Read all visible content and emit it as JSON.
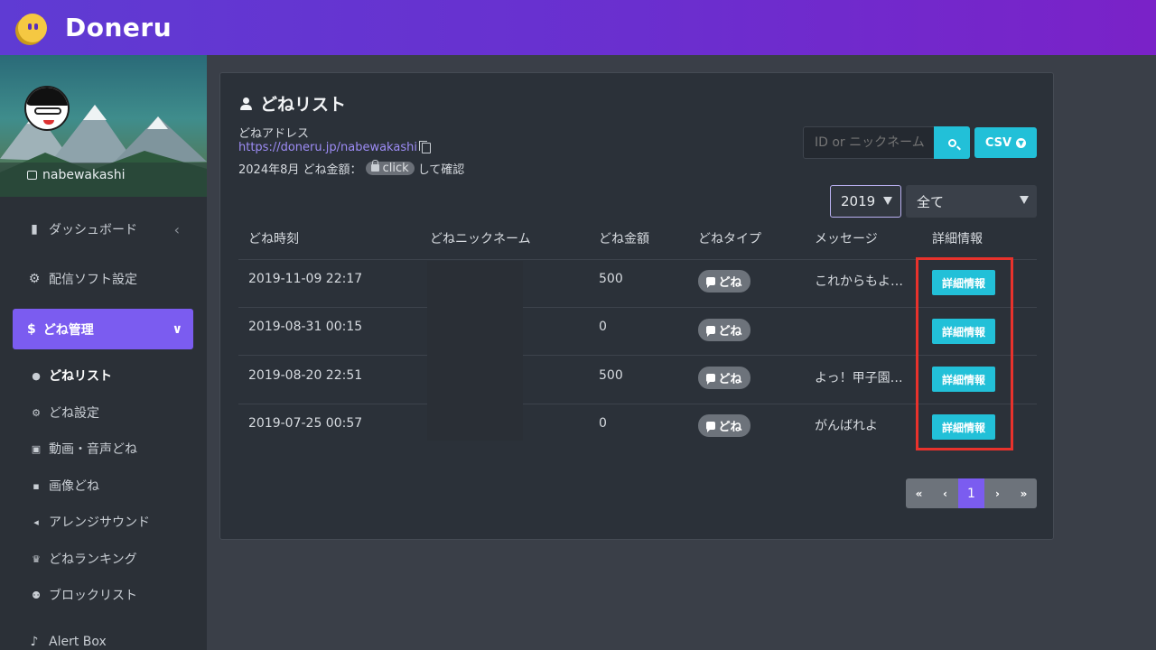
{
  "brand": {
    "name": "Doneru"
  },
  "sidebar": {
    "username": "nabewakashi",
    "items": [
      {
        "label": "ダッシュボード",
        "icon": "bar-chart-icon"
      },
      {
        "label": "配信ソフト設定",
        "icon": "gear-icon"
      },
      {
        "label": "どね管理",
        "icon": "dollar-icon"
      }
    ],
    "sub_items": [
      {
        "label": "どねリスト",
        "icon": "person-icon"
      },
      {
        "label": "どね設定",
        "icon": "gear-icon"
      },
      {
        "label": "動画・音声どね",
        "icon": "video-icon"
      },
      {
        "label": "画像どね",
        "icon": "image-icon"
      },
      {
        "label": "アレンジサウンド",
        "icon": "speaker-icon"
      },
      {
        "label": "どねランキング",
        "icon": "crown-icon"
      },
      {
        "label": "ブロックリスト",
        "icon": "block-user-icon"
      }
    ],
    "alert_box": "Alert Box"
  },
  "page": {
    "title": "どねリスト",
    "address_label": "どねアドレス",
    "address_url": "https://doneru.jp/nabewakashi",
    "amount_prefix": "2024年8月 どね金額：",
    "amount_hidden": "click",
    "amount_suffix": "して確認"
  },
  "search": {
    "placeholder": "ID or ニックネーム"
  },
  "csv_label": "CSV",
  "filters": {
    "year": "2019",
    "type": "全て"
  },
  "table": {
    "headers": [
      "どね時刻",
      "どねニックネーム",
      "どね金額",
      "どねタイプ",
      "メッセージ",
      "詳細情報"
    ],
    "rows": [
      {
        "time": "2019-11-09 22:17",
        "amount": "500",
        "type": "どね",
        "message": "これからもよ…",
        "detail": "詳細情報"
      },
      {
        "time": "2019-08-31 00:15",
        "amount": "0",
        "type": "どね",
        "message": "",
        "detail": "詳細情報"
      },
      {
        "time": "2019-08-20 22:51",
        "amount": "500",
        "type": "どね",
        "message": "よっ！甲子園…",
        "detail": "詳細情報"
      },
      {
        "time": "2019-07-25 00:57",
        "amount": "0",
        "type": "どね",
        "message": "がんばれよ",
        "detail": "詳細情報"
      }
    ]
  },
  "pagination": {
    "first": "«",
    "prev": "‹",
    "current": "1",
    "next": "›",
    "last": "»"
  },
  "colors": {
    "accent": "#7b5cf0",
    "button": "#22c0d8",
    "highlight": "#e8322c"
  }
}
